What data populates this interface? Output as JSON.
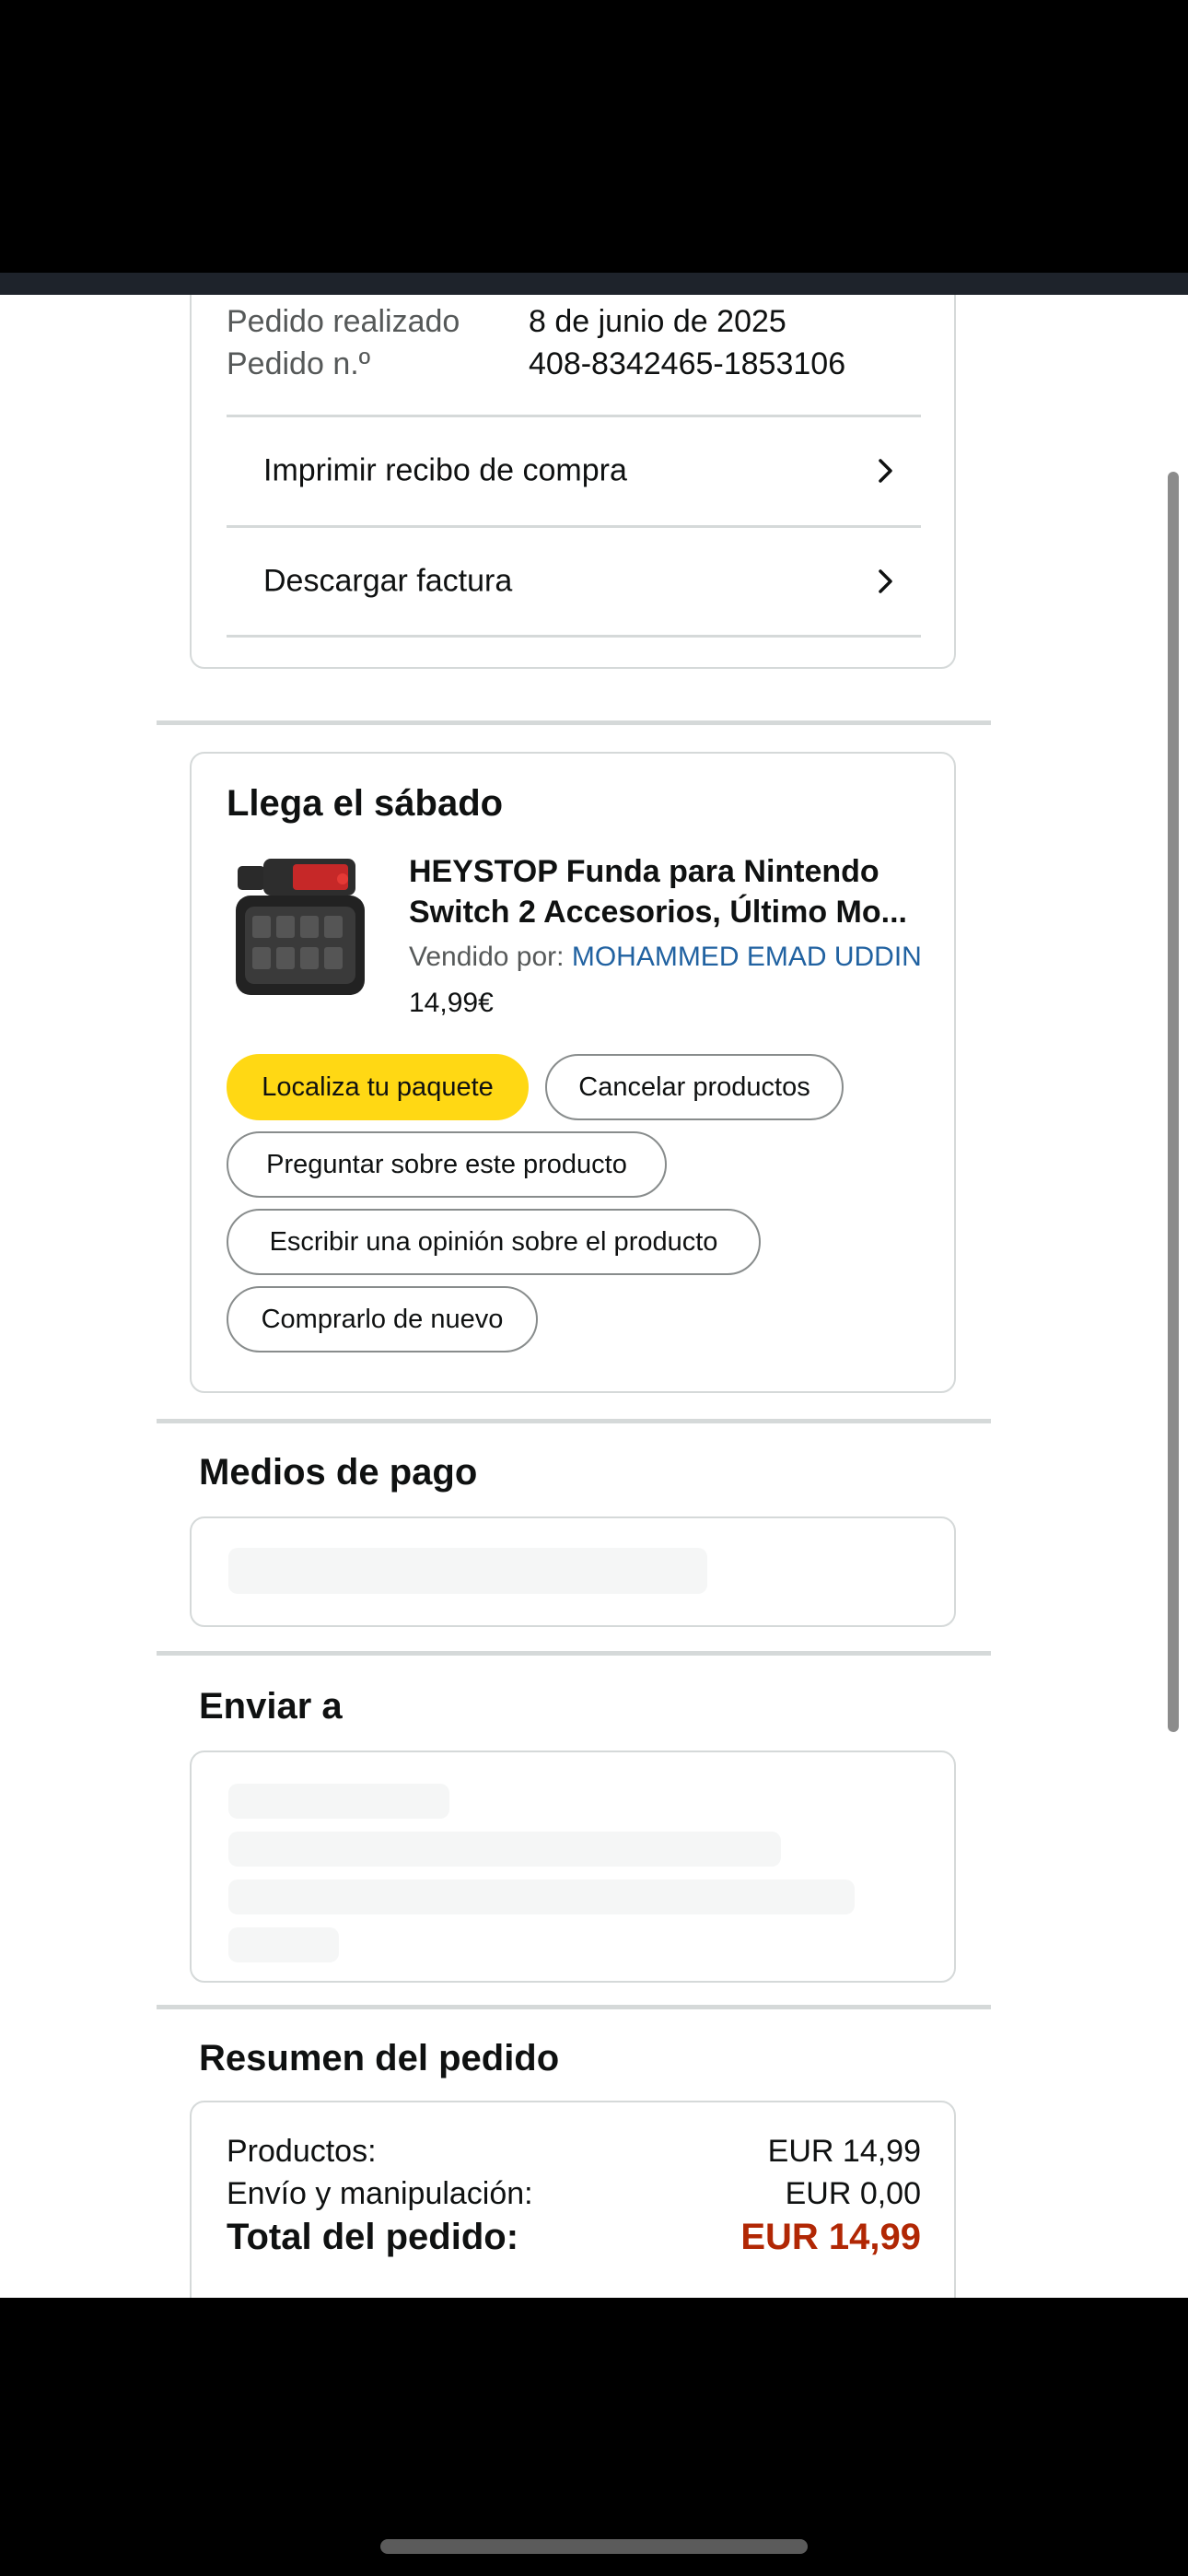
{
  "order": {
    "placed_label": "Pedido realizado",
    "placed_value": "8 de junio de 2025",
    "number_label": "Pedido n.º",
    "number_value": "408-8342465-1853106",
    "print_receipt": "Imprimir recibo de compra",
    "download_invoice": "Descargar factura"
  },
  "delivery": {
    "title": "Llega el sábado",
    "product": {
      "title": "HEYSTOP Funda para Nintendo Switch 2 Accesorios, Último Mo...",
      "sold_by_label": "Vendido por:",
      "seller": "MOHAMMED EMAD UDDIN",
      "price": "14,99€"
    },
    "actions": {
      "track": "Localiza tu paquete",
      "cancel": "Cancelar productos",
      "ask": "Preguntar sobre este producto",
      "review": "Escribir una opinión sobre el producto",
      "buy_again": "Comprarlo de nuevo"
    }
  },
  "payment": {
    "title": "Medios de pago"
  },
  "shipping": {
    "title": "Enviar a"
  },
  "summary": {
    "title": "Resumen del pedido",
    "products_label": "Productos:",
    "products_value": "EUR 14,99",
    "shipping_label": "Envío y manipulación:",
    "shipping_value": "EUR 0,00",
    "total_label": "Total del pedido:",
    "total_value": "EUR 14,99"
  },
  "colors": {
    "primary_button": "#ffd814",
    "seller_link": "#2162a1",
    "total_price": "#b12704"
  }
}
